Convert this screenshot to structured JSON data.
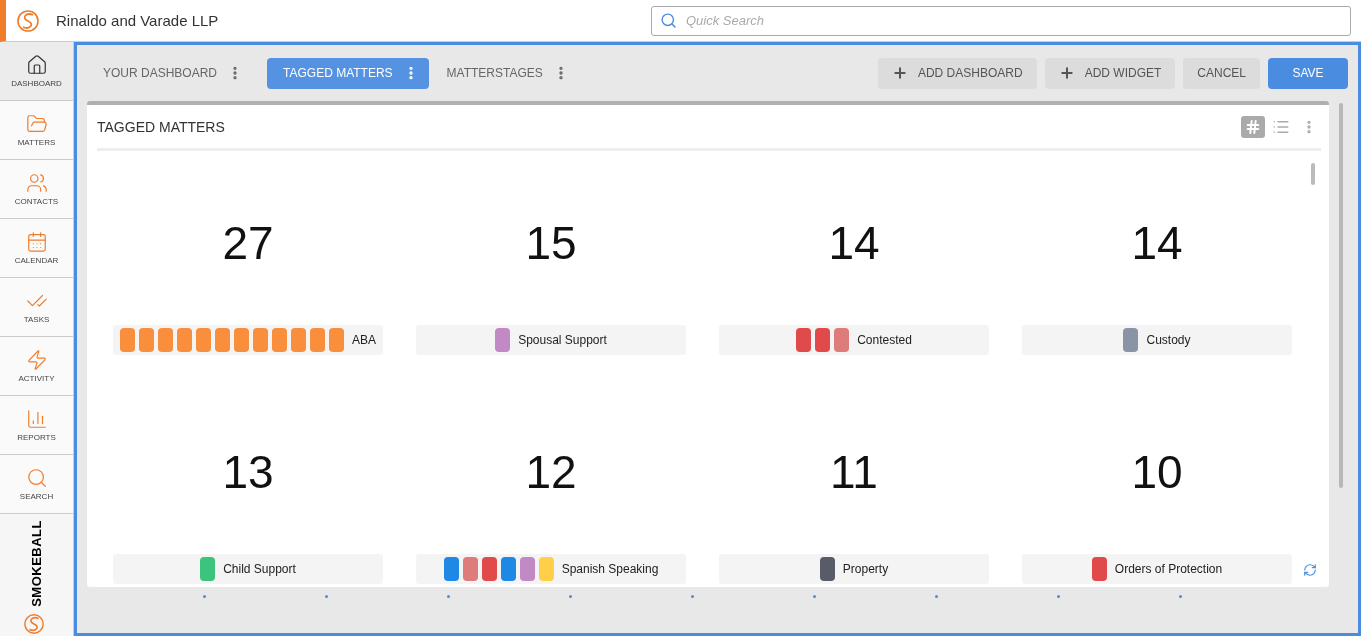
{
  "header": {
    "firm": "Rinaldo and Varade LLP",
    "search": {
      "placeholder": "Quick Search"
    }
  },
  "sidebar": {
    "items": [
      {
        "label": "DASHBOARD",
        "selected": true
      },
      {
        "label": "MATTERS",
        "selected": false
      },
      {
        "label": "CONTACTS",
        "selected": false
      },
      {
        "label": "CALENDAR",
        "selected": false
      },
      {
        "label": "TASKS",
        "selected": false
      },
      {
        "label": "ACTIVITY",
        "selected": false
      },
      {
        "label": "REPORTS",
        "selected": false
      },
      {
        "label": "SEARCH",
        "selected": false
      }
    ],
    "brand": "SMOKEBALL"
  },
  "tabs": [
    {
      "label": "YOUR DASHBOARD",
      "selected": false
    },
    {
      "label": "TAGGED MATTERS",
      "selected": true
    },
    {
      "label": "MATTERSTAGES",
      "selected": false
    }
  ],
  "actions": [
    {
      "label": "ADD DASHBOARD",
      "kind": "add"
    },
    {
      "label": "ADD WIDGET",
      "kind": "add"
    },
    {
      "label": "CANCEL",
      "kind": "plain"
    },
    {
      "label": "SAVE",
      "kind": "primary"
    }
  ],
  "widget": {
    "title": "TAGGED MATTERS",
    "tiles": [
      {
        "count": "27",
        "label": "ABA",
        "tags": [
          {
            "color": "#f98f3c"
          },
          {
            "color": "#f98f3c"
          },
          {
            "color": "#f98f3c"
          },
          {
            "color": "#f98f3c"
          },
          {
            "color": "#f98f3c"
          },
          {
            "color": "#f98f3c"
          },
          {
            "color": "#f98f3c"
          },
          {
            "color": "#f98f3c"
          },
          {
            "color": "#f98f3c"
          },
          {
            "color": "#f98f3c"
          },
          {
            "color": "#f98f3c"
          },
          {
            "color": "#f98f3c"
          }
        ]
      },
      {
        "count": "15",
        "label": "Spousal Support",
        "tags": [
          {
            "color": "#c28ac4"
          }
        ]
      },
      {
        "count": "14",
        "label": "Contested",
        "tags": [
          {
            "color": "#e04a4a"
          },
          {
            "color": "#e04a4a"
          },
          {
            "color": "#de7b7b"
          }
        ]
      },
      {
        "count": "14",
        "label": "Custody",
        "tags": [
          {
            "color": "#8a94a5"
          }
        ]
      },
      {
        "count": "13",
        "label": "Child Support",
        "tags": [
          {
            "color": "#3cc47c"
          }
        ]
      },
      {
        "count": "12",
        "label": "Spanish Speaking",
        "tags": [
          {
            "color": "#1e88e5"
          },
          {
            "color": "#de7b7b"
          },
          {
            "color": "#e04a4a"
          },
          {
            "color": "#1e88e5"
          },
          {
            "color": "#c28ac4"
          },
          {
            "color": "#ffcf4a"
          }
        ]
      },
      {
        "count": "11",
        "label": "Property",
        "tags": [
          {
            "color": "#575c66"
          }
        ]
      },
      {
        "count": "10",
        "label": "Orders of Protection",
        "tags": [
          {
            "color": "#e04a4a"
          }
        ]
      }
    ]
  }
}
